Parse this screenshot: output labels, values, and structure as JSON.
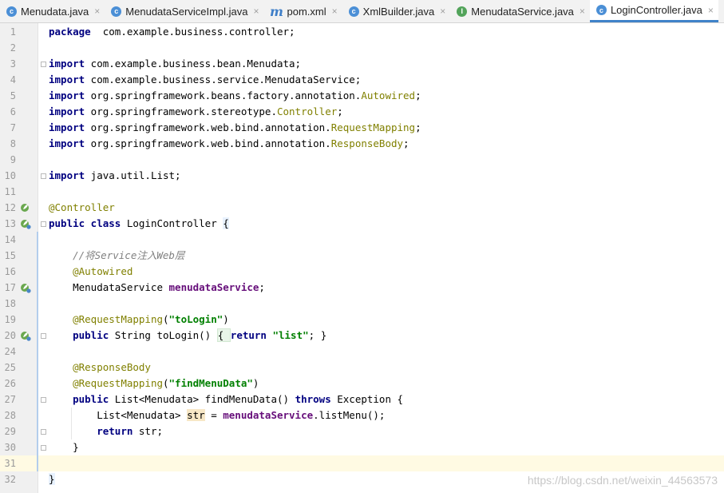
{
  "tabs": [
    {
      "label": "Menudata.java",
      "icon": "class-icon",
      "letter": "c",
      "active": false
    },
    {
      "label": "MenudataServiceImpl.java",
      "icon": "class-icon",
      "letter": "c",
      "active": false
    },
    {
      "label": "pom.xml",
      "icon": "maven-icon",
      "letter": "m",
      "active": false
    },
    {
      "label": "XmlBuilder.java",
      "icon": "class-icon",
      "letter": "c",
      "active": false
    },
    {
      "label": "MenudataService.java",
      "icon": "interface-icon",
      "letter": "I",
      "active": false
    },
    {
      "label": "LoginController.java",
      "icon": "class-icon",
      "letter": "c",
      "active": true
    }
  ],
  "close_glyph": "×",
  "current_line": "31",
  "colors": {
    "keyword": "#000080",
    "annotation": "#808000",
    "string": "#008000",
    "comment": "#808080",
    "field": "#660e7a",
    "current_line_bg": "#fffae3",
    "active_tab_underline": "#4083c9"
  },
  "lines": [
    {
      "n": "1",
      "tokens": [
        [
          "kw",
          "package"
        ],
        [
          "",
          "  com.example.business.controller;"
        ]
      ]
    },
    {
      "n": "2",
      "tokens": []
    },
    {
      "n": "3",
      "tokens": [
        [
          "kw",
          "import"
        ],
        [
          "",
          " com.example.business.bean.Menudata;"
        ]
      ]
    },
    {
      "n": "4",
      "tokens": [
        [
          "kw",
          "import"
        ],
        [
          "",
          " com.example.business.service.MenudataService;"
        ]
      ]
    },
    {
      "n": "5",
      "tokens": [
        [
          "kw",
          "import"
        ],
        [
          "",
          " org.springframework.beans.factory.annotation."
        ],
        [
          "an",
          "Autowired"
        ],
        [
          "",
          ";"
        ]
      ]
    },
    {
      "n": "6",
      "tokens": [
        [
          "kw",
          "import"
        ],
        [
          "",
          " org.springframework.stereotype."
        ],
        [
          "an",
          "Controller"
        ],
        [
          "",
          ";"
        ]
      ]
    },
    {
      "n": "7",
      "tokens": [
        [
          "kw",
          "import"
        ],
        [
          "",
          " org.springframework.web.bind.annotation."
        ],
        [
          "an",
          "RequestMapping"
        ],
        [
          "",
          ";"
        ]
      ]
    },
    {
      "n": "8",
      "tokens": [
        [
          "kw",
          "import"
        ],
        [
          "",
          " org.springframework.web.bind.annotation."
        ],
        [
          "an",
          "ResponseBody"
        ],
        [
          "",
          ";"
        ]
      ]
    },
    {
      "n": "9",
      "tokens": []
    },
    {
      "n": "10",
      "tokens": [
        [
          "kw",
          "import"
        ],
        [
          "",
          " java.util.List;"
        ]
      ]
    },
    {
      "n": "11",
      "tokens": []
    },
    {
      "n": "12",
      "tokens": [
        [
          "an",
          "@Controller"
        ]
      ]
    },
    {
      "n": "13",
      "tokens": [
        [
          "kw",
          "public class"
        ],
        [
          "",
          " LoginController "
        ],
        [
          "brace-hl",
          "{"
        ]
      ]
    },
    {
      "n": "14",
      "tokens": []
    },
    {
      "n": "15",
      "tokens": [
        [
          "",
          "    "
        ],
        [
          "cm",
          "//将Service注入Web层"
        ]
      ]
    },
    {
      "n": "16",
      "tokens": [
        [
          "",
          "    "
        ],
        [
          "an",
          "@Autowired"
        ]
      ]
    },
    {
      "n": "17",
      "tokens": [
        [
          "",
          "    MenudataService "
        ],
        [
          "fld",
          "menudataService"
        ],
        [
          "",
          ";"
        ]
      ]
    },
    {
      "n": "18",
      "tokens": []
    },
    {
      "n": "19",
      "tokens": [
        [
          "",
          "    "
        ],
        [
          "an",
          "@RequestMapping"
        ],
        [
          "",
          "("
        ],
        [
          "str",
          "\"toLogin\""
        ],
        [
          "",
          ")"
        ]
      ]
    },
    {
      "n": "20",
      "tokens": [
        [
          "",
          "    "
        ],
        [
          "kw",
          "public"
        ],
        [
          "",
          " String toLogin() "
        ],
        [
          "fold-box",
          "{ "
        ],
        [
          "kw",
          "return"
        ],
        [
          "",
          " "
        ],
        [
          "str",
          "\"list\""
        ],
        [
          "",
          "; }"
        ]
      ]
    },
    {
      "n": "24",
      "tokens": []
    },
    {
      "n": "25",
      "tokens": [
        [
          "",
          "    "
        ],
        [
          "an",
          "@ResponseBody"
        ]
      ]
    },
    {
      "n": "26",
      "tokens": [
        [
          "",
          "    "
        ],
        [
          "an",
          "@RequestMapping"
        ],
        [
          "",
          "("
        ],
        [
          "str",
          "\"findMenuData\""
        ],
        [
          "",
          ")"
        ]
      ]
    },
    {
      "n": "27",
      "tokens": [
        [
          "",
          "    "
        ],
        [
          "kw",
          "public"
        ],
        [
          "",
          " List<Menudata> findMenuData() "
        ],
        [
          "kw",
          "throws"
        ],
        [
          "",
          " Exception {"
        ]
      ]
    },
    {
      "n": "28",
      "tokens": [
        [
          "",
          "        List<Menudata> "
        ],
        [
          "hl-var",
          "str"
        ],
        [
          "",
          " = "
        ],
        [
          "fld",
          "menudataService"
        ],
        [
          "",
          ".listMenu();"
        ]
      ]
    },
    {
      "n": "29",
      "tokens": [
        [
          "",
          "        "
        ],
        [
          "kw",
          "return"
        ],
        [
          "",
          " str;"
        ]
      ]
    },
    {
      "n": "30",
      "tokens": [
        [
          "",
          "    }"
        ]
      ]
    },
    {
      "n": "31",
      "tokens": []
    },
    {
      "n": "32",
      "tokens": [
        [
          "brace-hl",
          "}"
        ]
      ]
    }
  ],
  "gutter_icons": [
    {
      "line": "12",
      "icon": "spring-bean-icon"
    },
    {
      "line": "13",
      "icon": "spring-bean-navigate-icon"
    },
    {
      "line": "17",
      "icon": "autowired-bean-icon"
    },
    {
      "line": "20",
      "icon": "request-mapping-icon"
    }
  ],
  "watermark": "https://blog.csdn.net/weixin_44563573"
}
